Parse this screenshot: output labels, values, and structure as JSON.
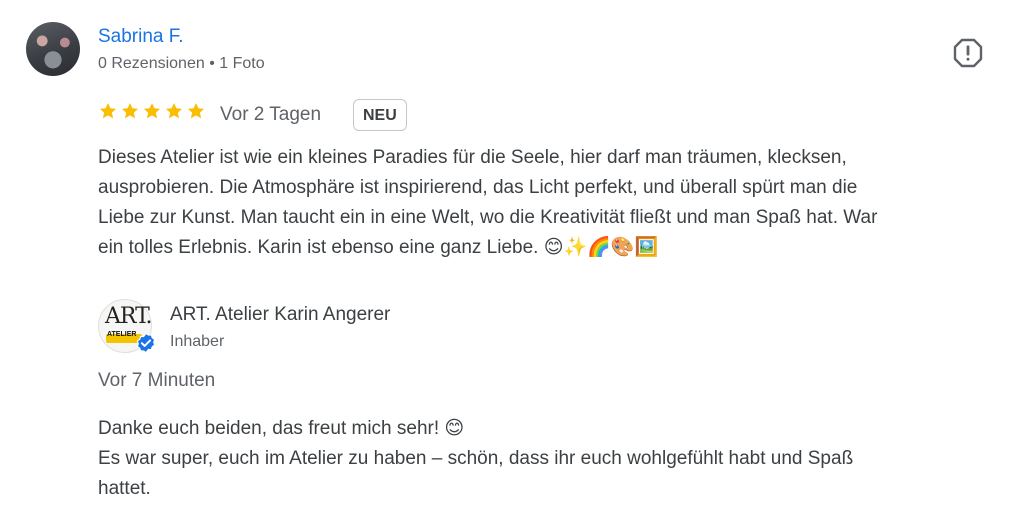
{
  "review": {
    "reviewer_name": "Sabrina F.",
    "reviewer_meta": "0 Rezensionen • 1 Foto",
    "rating": 5,
    "date": "Vor 2 Tagen",
    "badge": "NEU",
    "text": "Dieses Atelier ist wie ein kleines Paradies für die Seele, hier darf man träumen, klecksen,\nausprobieren. Die Atmosphäre ist inspirierend, das Licht perfekt, und überall spürt man die\nLiebe zur Kunst. Man taucht ein in eine Welt, wo die Kreativität fließt und man Spaß hat. War\nein tolles Erlebnis. Karin ist ebenso eine ganz Liebe. 😊✨🌈🎨🖼️"
  },
  "owner_reply": {
    "logo_text": "ART.",
    "logo_sub": "ATELIER",
    "owner_name": "ART. Atelier Karin Angerer",
    "owner_role": "Inhaber",
    "date": "Vor 7 Minuten",
    "text": "Danke euch beiden, das freut mich sehr! 😊\nEs war super, euch im Atelier zu haben – schön, dass ihr euch wohlgefühlt habt und Spaß\nhattet."
  },
  "colors": {
    "link_blue": "#1a73e8",
    "star_gold": "#fbbc04",
    "verified_blue": "#1a73e8",
    "muted_text": "#5f6368"
  },
  "icons": {
    "report": "flag-report-icon",
    "star": "star-icon",
    "verified": "verified-check-icon"
  }
}
